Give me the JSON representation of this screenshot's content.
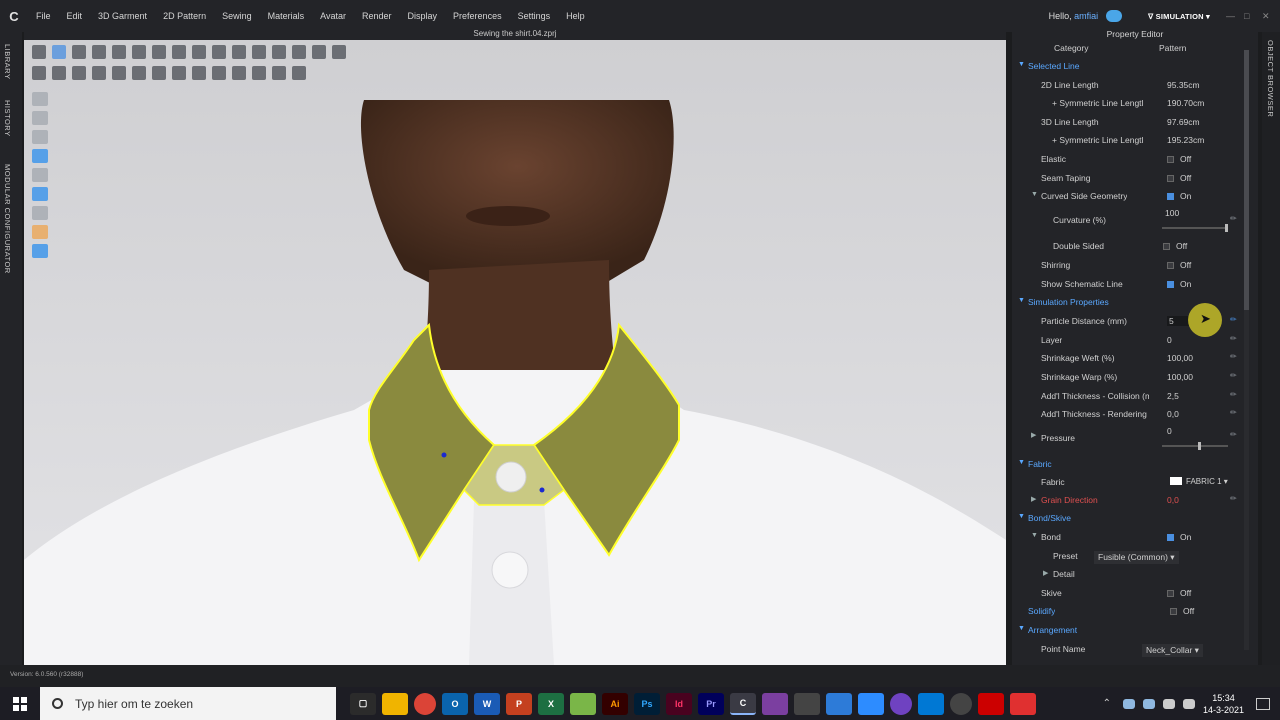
{
  "app": {
    "logo": "C",
    "menu": [
      "File",
      "Edit",
      "3D Garment",
      "2D Pattern",
      "Sewing",
      "Materials",
      "Avatar",
      "Render",
      "Display",
      "Preferences",
      "Settings",
      "Help"
    ],
    "hello_prefix": "Hello,",
    "user": "amfiai",
    "mode": "SIMULATION",
    "file_title": "Sewing the shirt.04.zprj",
    "version": "Version: 6.0.560 (r32888)"
  },
  "left_tabs": [
    "LIBRARY",
    "HISTORY",
    "MODULAR CONFIGURATOR"
  ],
  "right_tabs": [
    "OBJECT BROWSER"
  ],
  "panel": {
    "title": "Property Editor",
    "category_label": "Category",
    "category_value": "Pattern",
    "rows": [
      {
        "label": "Selected Line",
        "type": "section"
      },
      {
        "label": "2D Line Length",
        "value": "95.35cm"
      },
      {
        "label": "+ Symmetric Line Lengtl",
        "value": "190.70cm"
      },
      {
        "label": "3D Line Length",
        "value": "97.69cm"
      },
      {
        "label": "+ Symmetric Line Lengtl",
        "value": "195.23cm"
      },
      {
        "label": "Elastic",
        "check": false,
        "value": "Off"
      },
      {
        "label": "Seam Taping",
        "check": false,
        "value": "Off"
      },
      {
        "label": "Curved Side Geometry",
        "check": true,
        "value": "On"
      },
      {
        "label": "Curvature (%)",
        "value": "100",
        "slider": 0.97
      },
      {
        "label": "Double Sided",
        "check": false,
        "value": "Off"
      },
      {
        "label": "Shirring",
        "check": false,
        "value": "Off"
      },
      {
        "label": "Show Schematic Line",
        "check": true,
        "value": "On"
      },
      {
        "label": "Simulation Properties",
        "type": "section"
      },
      {
        "label": "Particle Distance (mm)",
        "value": "5"
      },
      {
        "label": "Layer",
        "value": "0"
      },
      {
        "label": "Shrinkage Weft (%)",
        "value": "100,00"
      },
      {
        "label": "Shrinkage Warp (%)",
        "value": "100,00"
      },
      {
        "label": "Add'l Thickness - Collision (mi",
        "value": "2,5"
      },
      {
        "label": "Add'l Thickness - Rendering (n",
        "value": "0,0"
      },
      {
        "label": "Pressure",
        "value": "0",
        "slider": 0.55
      },
      {
        "label": "Fabric",
        "type": "section"
      },
      {
        "label": "Fabric",
        "value": "FABRIC 1"
      },
      {
        "label": "Grain Direction",
        "value": "0,0"
      },
      {
        "label": "Bond/Skive",
        "type": "section"
      },
      {
        "label": "Bond",
        "check": true,
        "value": "On"
      },
      {
        "label": "Preset",
        "value": "Fusible (Common)"
      },
      {
        "label": "Detail"
      },
      {
        "label": "Skive",
        "check": false,
        "value": "Off"
      },
      {
        "label": "Solidify",
        "check": false,
        "value": "Off"
      },
      {
        "label": "Arrangement",
        "type": "section"
      },
      {
        "label": "Point Name",
        "value": "Neck_Collar"
      }
    ]
  },
  "taskbar": {
    "search_placeholder": "Typ hier om te zoeken",
    "apps": [
      "Ai",
      "Id",
      "Pr",
      "Ps",
      "W",
      "P",
      "X"
    ],
    "time": "15:34",
    "date": "14-3-2021"
  }
}
